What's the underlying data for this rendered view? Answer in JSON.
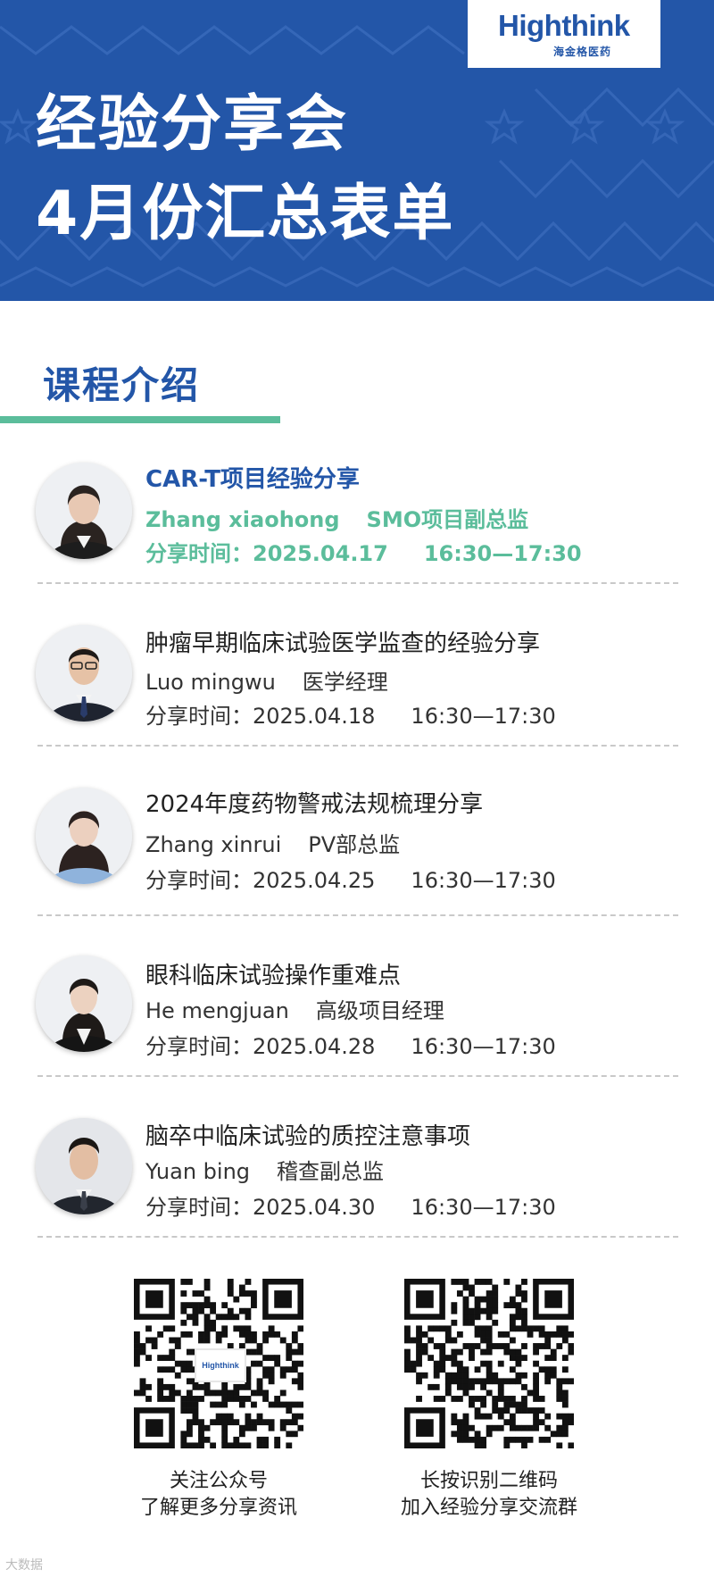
{
  "header": {
    "brand": "Highthink",
    "brand_cn": "海金格医药",
    "title_line1": "经验分享会",
    "title_line2": "4月份汇总表单",
    "colors": {
      "blue": "#2356a8",
      "green": "#5bbd9b"
    }
  },
  "section": {
    "title": "课程介绍"
  },
  "courses": [
    {
      "title": "CAR-T项目经验分享",
      "speaker": "Zhang xiaohong",
      "role": "SMO项目副总监",
      "time_label": "分享时间：",
      "date": "2025.04.17",
      "time": "16:30—17:30"
    },
    {
      "title": "肿瘤早期临床试验医学监查的经验分享",
      "speaker": "Luo mingwu",
      "role": "医学经理",
      "time_label": "分享时间：",
      "date": "2025.04.18",
      "time": "16:30—17:30"
    },
    {
      "title": "2024年度药物警戒法规梳理分享",
      "speaker": "Zhang xinrui",
      "role": "PV部总监",
      "time_label": "分享时间：",
      "date": "2025.04.25",
      "time": "16:30—17:30"
    },
    {
      "title": "眼科临床试验操作重难点",
      "speaker": "He mengjuan",
      "role": "高级项目经理",
      "time_label": "分享时间：",
      "date": "2025.04.28",
      "time": "16:30—17:30"
    },
    {
      "title": "脑卒中临床试验的质控注意事项",
      "speaker": "Yuan bing",
      "role": "稽查副总监",
      "time_label": "分享时间：",
      "date": "2025.04.30",
      "time": "16:30—17:30"
    }
  ],
  "qr": {
    "left_logo": "Highthink",
    "left_line1": "关注公众号",
    "left_line2": "了解更多分享资讯",
    "right_line1": "长按识别二维码",
    "right_line2": "加入经验分享交流群"
  },
  "watermark": "大数据"
}
